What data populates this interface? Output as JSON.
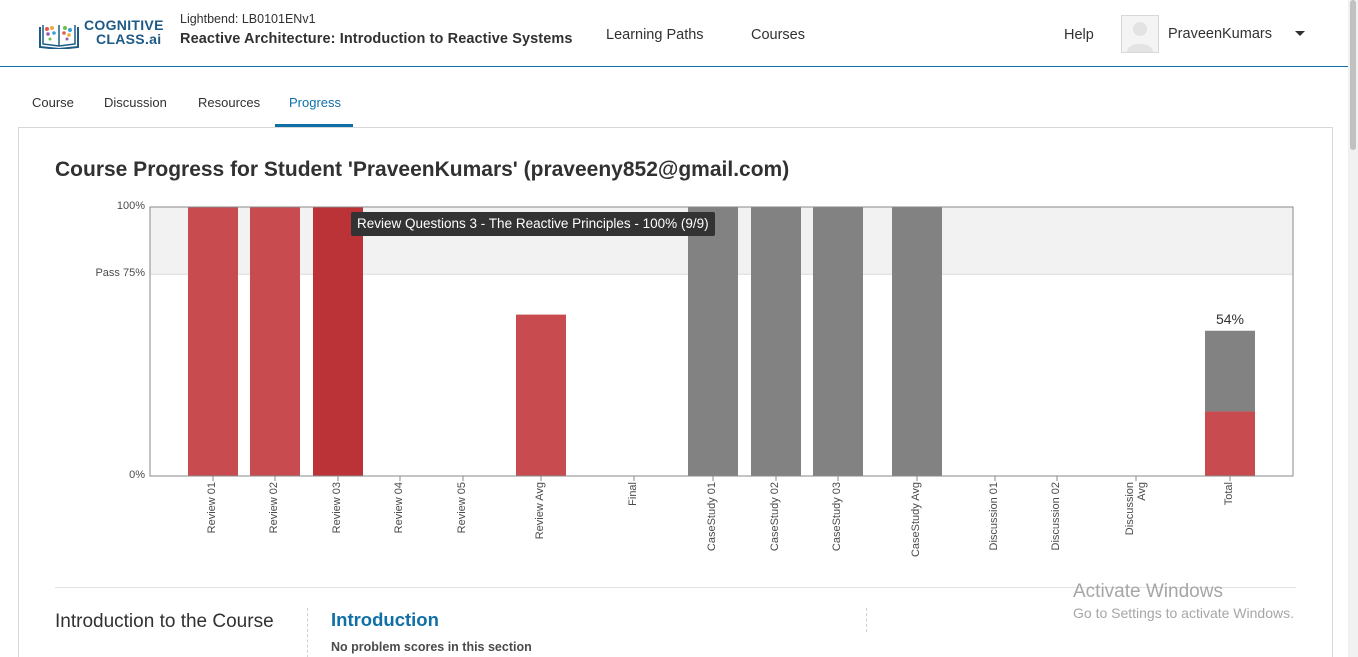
{
  "header": {
    "logo_line1": "COGNITIVE",
    "logo_line2": "CLASS.ai",
    "course_org": "Lightbend: LB0101ENv1",
    "course_title": "Reactive Architecture: Introduction to Reactive Systems",
    "nav": {
      "learning_paths": "Learning Paths",
      "courses": "Courses",
      "help": "Help"
    },
    "username": "PraveenKumars"
  },
  "tabs": {
    "course": "Course",
    "discussion": "Discussion",
    "resources": "Resources",
    "progress": "Progress",
    "active": "progress"
  },
  "page_title": "Course Progress for Student 'PraveenKumars' (praveeny852@gmail.com)",
  "tooltip": "Review Questions 3 - The Reactive Principles - 100% (9/9)",
  "chart_data": {
    "type": "bar",
    "categories": [
      "Review 01",
      "Review 02",
      "Review 03",
      "Review 04",
      "Review 05",
      "Review Avg",
      "Final",
      "CaseStudy 01",
      "CaseStudy 02",
      "CaseStudy 03",
      "CaseStudy Avg",
      "Discussion 01",
      "Discussion 02",
      "Discussion Avg",
      "Total"
    ],
    "series": [
      {
        "values": [
          100,
          100,
          100,
          0,
          0,
          60,
          0,
          0,
          0,
          0,
          0,
          0,
          0,
          0,
          24
        ]
      },
      {
        "values": [
          0,
          0,
          0,
          0,
          0,
          0,
          0,
          100,
          100,
          100,
          100,
          0,
          0,
          0,
          30
        ]
      }
    ],
    "y_tick_labels": [
      "100%",
      "Pass 75%",
      "0%"
    ],
    "ylim": [
      0,
      100
    ],
    "pass_threshold": 75,
    "total_label": "54%",
    "colors": {
      "score": "#c74b4f",
      "score_highlight": "#bb3336",
      "remaining": "#828282",
      "pass_band": "#f2f2f2"
    }
  },
  "section": {
    "name": "Introduction to the Course",
    "subsection_title": "Introduction",
    "no_scores": "No problem scores in this section"
  },
  "watermark": {
    "line1": "Activate Windows",
    "line2": "Go to Settings to activate Windows."
  }
}
